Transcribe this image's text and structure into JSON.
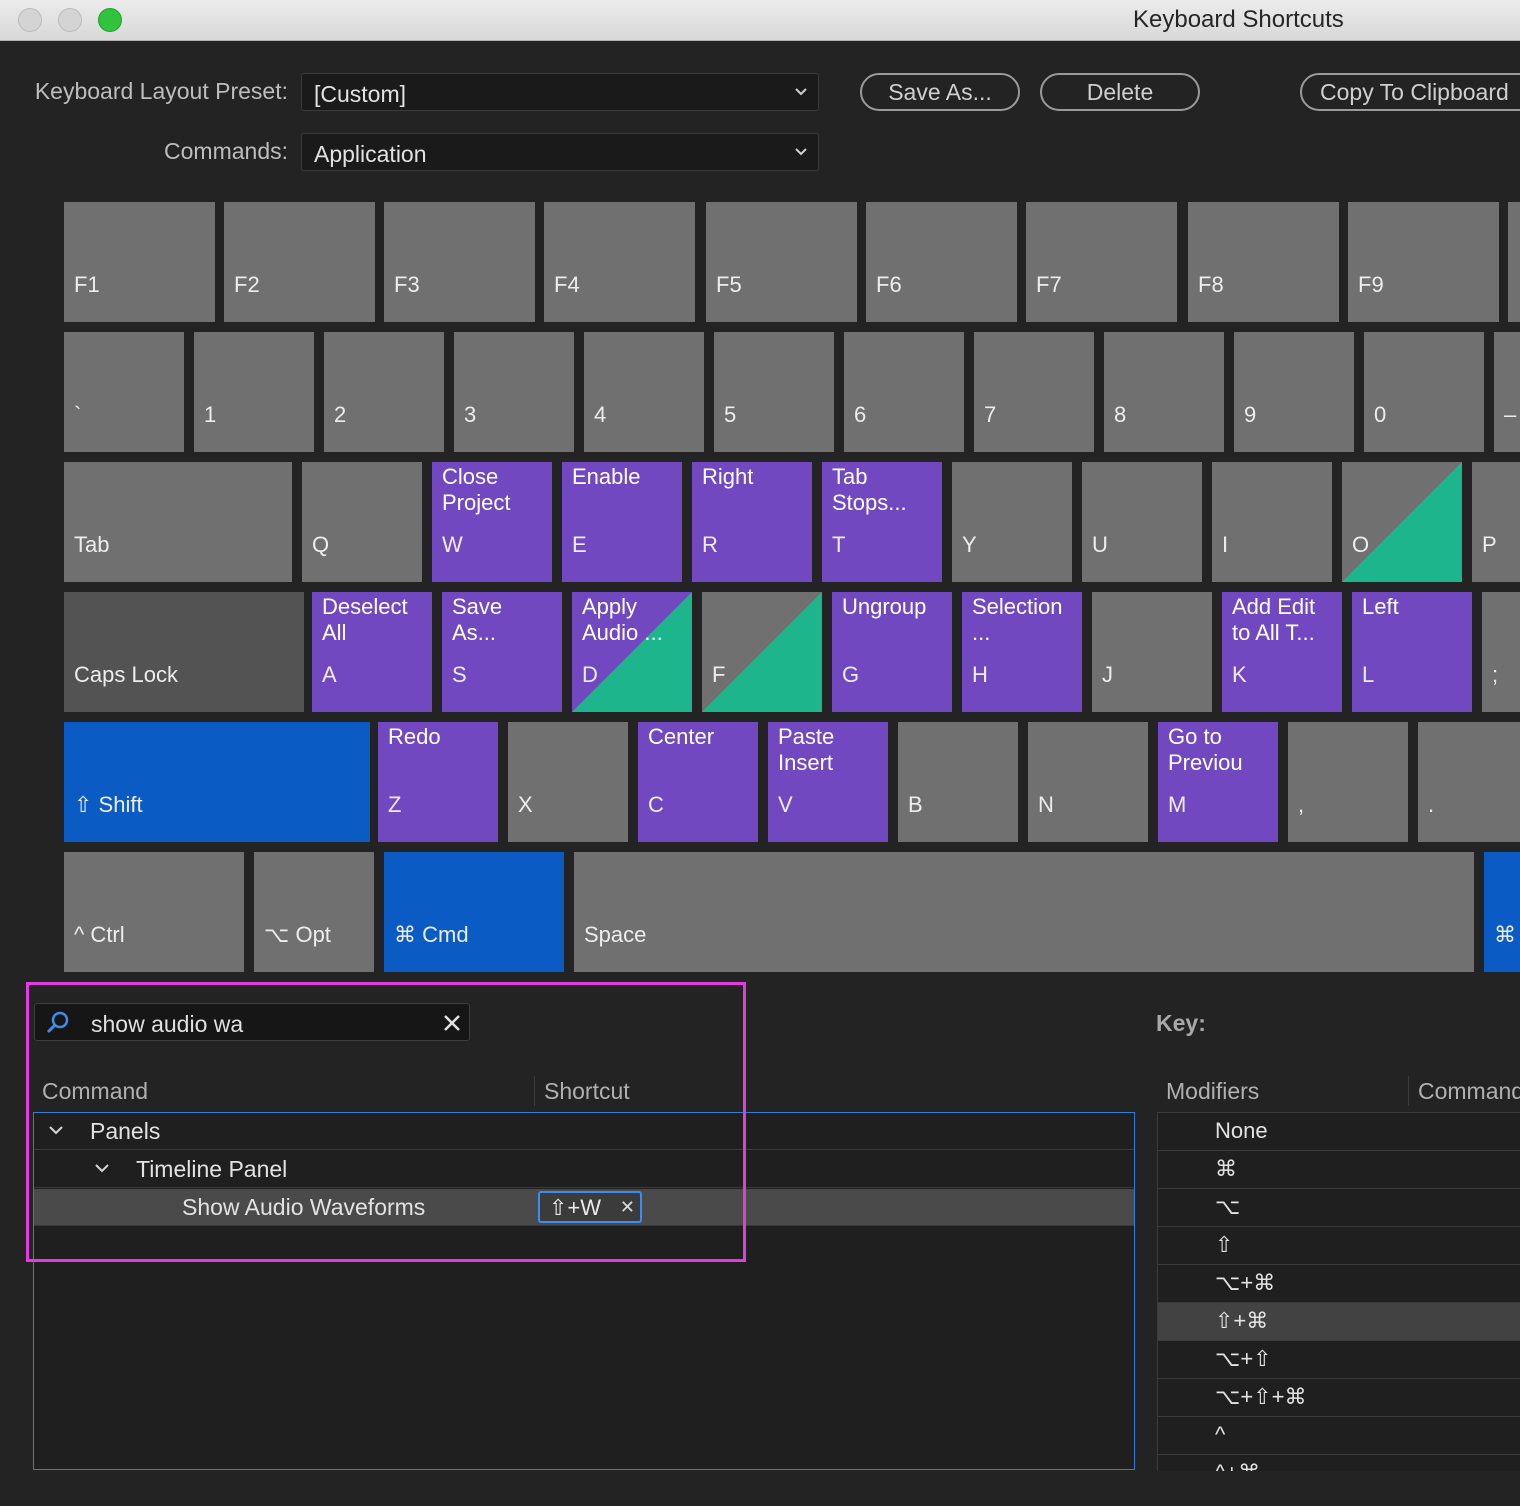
{
  "window": {
    "title": "Keyboard Shortcuts"
  },
  "preset": {
    "label": "Keyboard Layout Preset:",
    "value": "[Custom]"
  },
  "commands_filter": {
    "label": "Commands:",
    "value": "Application"
  },
  "buttons": {
    "save_as": "Save As...",
    "delete": "Delete",
    "copy": "Copy To Clipboard"
  },
  "keyboard": {
    "function_row": [
      "F1",
      "F2",
      "F3",
      "F4",
      "F5",
      "F6",
      "F7",
      "F8",
      "F9"
    ],
    "number_row": [
      "`",
      "1",
      "2",
      "3",
      "4",
      "5",
      "6",
      "7",
      "8",
      "9",
      "0",
      "–"
    ],
    "qwerty_row": [
      {
        "key": "Tab",
        "command": ""
      },
      {
        "key": "Q",
        "command": ""
      },
      {
        "key": "W",
        "command": "Close\nProject"
      },
      {
        "key": "E",
        "command": "Enable"
      },
      {
        "key": "R",
        "command": "Right"
      },
      {
        "key": "T",
        "command": "Tab\nStops..."
      },
      {
        "key": "Y",
        "command": ""
      },
      {
        "key": "U",
        "command": ""
      },
      {
        "key": "I",
        "command": ""
      },
      {
        "key": "O",
        "command": ""
      },
      {
        "key": "P",
        "command": ""
      }
    ],
    "home_row": [
      {
        "key": "Caps Lock",
        "command": ""
      },
      {
        "key": "A",
        "command": "Deselect\nAll"
      },
      {
        "key": "S",
        "command": "Save\nAs..."
      },
      {
        "key": "D",
        "command": "Apply\nAudio ..."
      },
      {
        "key": "F",
        "command": ""
      },
      {
        "key": "G",
        "command": "Ungroup"
      },
      {
        "key": "H",
        "command": "Selection\n..."
      },
      {
        "key": "J",
        "command": ""
      },
      {
        "key": "K",
        "command": "Add Edit\nto All T..."
      },
      {
        "key": "L",
        "command": "Left"
      },
      {
        "key": ";",
        "command": ""
      }
    ],
    "bottom_row": [
      {
        "key": "⇧ Shift",
        "command": ""
      },
      {
        "key": "Z",
        "command": "Redo"
      },
      {
        "key": "X",
        "command": ""
      },
      {
        "key": "C",
        "command": "Center"
      },
      {
        "key": "V",
        "command": "Paste\nInsert"
      },
      {
        "key": "B",
        "command": ""
      },
      {
        "key": "N",
        "command": ""
      },
      {
        "key": "M",
        "command": "Go to\nPreviou"
      },
      {
        "key": ",",
        "command": ""
      },
      {
        "key": ".",
        "command": ""
      }
    ],
    "space_row": [
      "^ Ctrl",
      "⌥ Opt",
      "⌘ Cmd",
      "Space",
      "⌘"
    ],
    "colors": {
      "key": "#707070",
      "app_command": "#7248c0",
      "panel_command": "#1db58c",
      "modifier_active": "#0a5cc4"
    }
  },
  "search": {
    "value": "show audio wa"
  },
  "table": {
    "col_command": "Command",
    "col_shortcut": "Shortcut",
    "rows": [
      {
        "label": "Panels"
      },
      {
        "label": "Timeline Panel"
      },
      {
        "label": "Show Audio Waveforms",
        "shortcut": "⇧+W"
      }
    ]
  },
  "legend": {
    "title": "Key:",
    "col_modifiers": "Modifiers",
    "col_command": "Command",
    "modifiers": [
      "None",
      "⌘",
      "⌥",
      "⇧",
      "⌥+⌘",
      "⇧+⌘",
      "⌥+⇧",
      "⌥+⇧+⌘",
      "^",
      "^+⌘"
    ],
    "selected_index": 5
  }
}
